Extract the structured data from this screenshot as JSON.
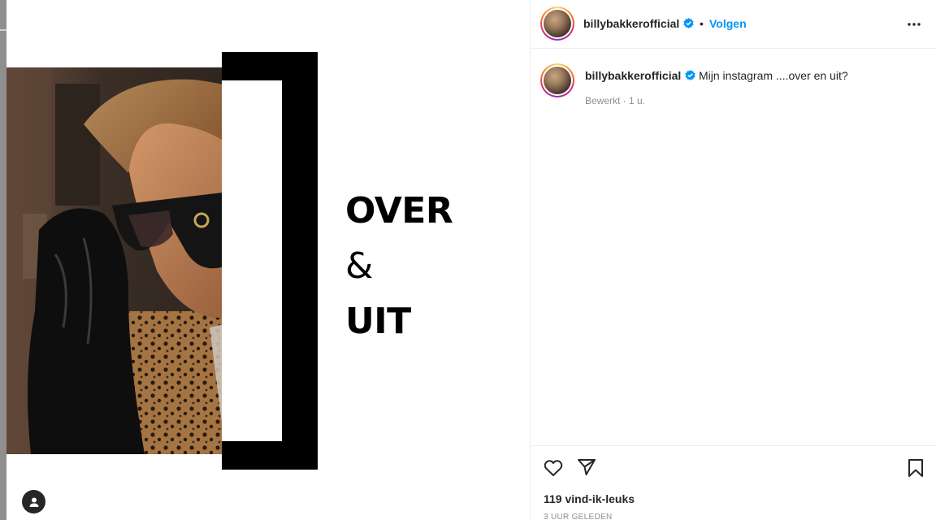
{
  "post": {
    "poster_lines": [
      "OVER",
      "&",
      "UIT"
    ]
  },
  "header": {
    "username": "billybakkerofficial",
    "separator": "•",
    "follow_label": "Volgen"
  },
  "caption": {
    "username": "billybakkerofficial",
    "text": "Mijn instagram ....over en uit?",
    "meta": "Bewerkt · 1 u."
  },
  "footer": {
    "likes": "119 vind-ik-leuks",
    "timestamp": "3 UUR GELEDEN"
  },
  "colors": {
    "accent": "#0095f6",
    "verified": "#0095f6",
    "text": "#262626",
    "muted": "#8e8e8e"
  },
  "icons": {
    "more": "more-horizontal-icon",
    "like": "heart-icon",
    "share": "send-icon",
    "save": "bookmark-icon",
    "verified": "verified-badge-icon",
    "user": "user-icon"
  }
}
